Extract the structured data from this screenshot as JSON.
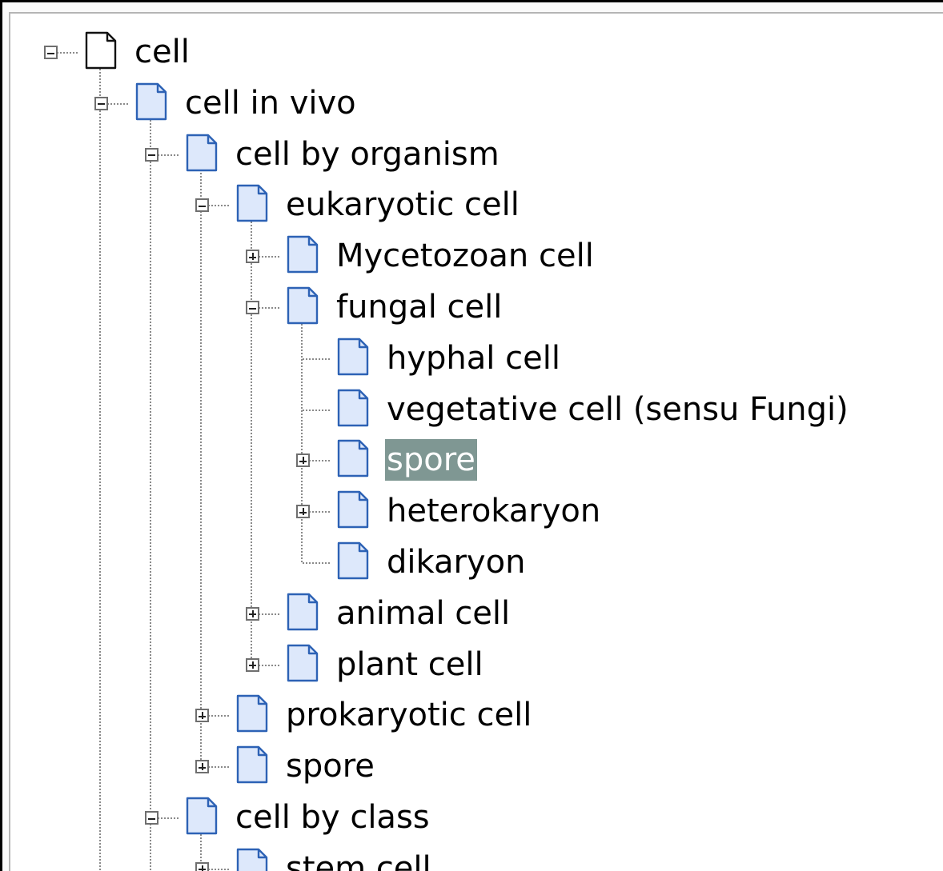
{
  "tree": {
    "nodes": [
      {
        "label": "cell",
        "depth": 0,
        "toggle": "minus",
        "icon": "page-white-icon"
      },
      {
        "label": "cell in vivo",
        "depth": 1,
        "toggle": "minus",
        "icon": "page-blue-icon"
      },
      {
        "label": "cell by organism",
        "depth": 2,
        "toggle": "minus",
        "icon": "page-blue-icon"
      },
      {
        "label": "eukaryotic cell",
        "depth": 3,
        "toggle": "minus",
        "icon": "page-blue-icon"
      },
      {
        "label": "Mycetozoan cell",
        "depth": 4,
        "toggle": "plus",
        "icon": "page-blue-icon"
      },
      {
        "label": "fungal cell",
        "depth": 4,
        "toggle": "minus",
        "icon": "page-blue-icon"
      },
      {
        "label": "hyphal cell",
        "depth": 5,
        "toggle": "none",
        "icon": "page-blue-icon"
      },
      {
        "label": "vegetative cell (sensu Fungi)",
        "depth": 5,
        "toggle": "none",
        "icon": "page-blue-icon"
      },
      {
        "label": "spore",
        "depth": 5,
        "toggle": "plus",
        "icon": "page-blue-icon",
        "selected": true
      },
      {
        "label": "heterokaryon",
        "depth": 5,
        "toggle": "plus",
        "icon": "page-blue-icon"
      },
      {
        "label": "dikaryon",
        "depth": 5,
        "toggle": "none",
        "icon": "page-blue-icon"
      },
      {
        "label": "animal cell",
        "depth": 4,
        "toggle": "plus",
        "icon": "page-blue-icon"
      },
      {
        "label": "plant cell",
        "depth": 4,
        "toggle": "plus",
        "icon": "page-blue-icon"
      },
      {
        "label": "prokaryotic cell",
        "depth": 3,
        "toggle": "plus",
        "icon": "page-blue-icon"
      },
      {
        "label": "spore",
        "depth": 3,
        "toggle": "plus",
        "icon": "page-blue-icon"
      },
      {
        "label": "cell by class",
        "depth": 2,
        "toggle": "minus",
        "icon": "page-blue-icon"
      },
      {
        "label": "stem cell",
        "depth": 3,
        "toggle": "plus",
        "icon": "page-blue-icon"
      }
    ]
  },
  "colors": {
    "selection_background": "#7f9793",
    "selection_text": "#ffffff",
    "node_icon_fill": "#dde8fb",
    "node_icon_stroke": "#2d62b5",
    "root_icon_fill": "#ffffff",
    "root_icon_stroke": "#111111",
    "connector_line": "#8a8a8a"
  }
}
